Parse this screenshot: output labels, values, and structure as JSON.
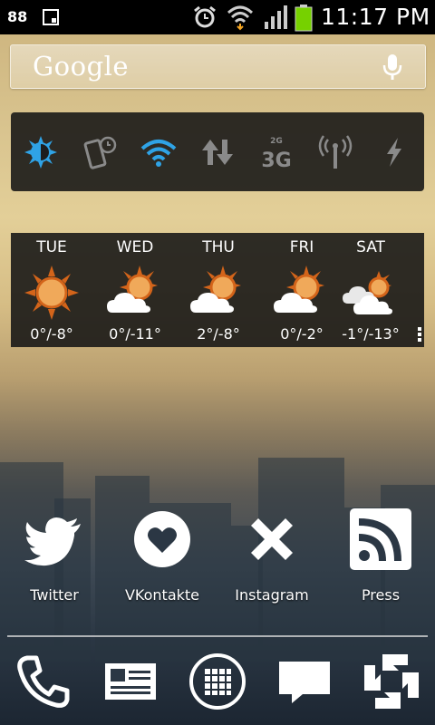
{
  "status_bar": {
    "left_number": "88",
    "time": "11:17 PM",
    "icons": [
      "sim-card-icon",
      "alarm-icon",
      "wifi-icon",
      "signal-icon",
      "battery-icon"
    ]
  },
  "search": {
    "logo_text": "Google",
    "icon": "microphone-icon"
  },
  "power_widget": {
    "items": [
      "brightness",
      "auto-rotate",
      "wifi",
      "data",
      "3g",
      "hotspot",
      "flashlight"
    ],
    "active_color": "#2fa3e6",
    "inactive_color": "#8a8a8a"
  },
  "weather": {
    "days": [
      {
        "name": "TUE",
        "temp": "0°/-8°",
        "condition": "sunny"
      },
      {
        "name": "WED",
        "temp": "0°/-11°",
        "condition": "partly-cloudy"
      },
      {
        "name": "THU",
        "temp": "2°/-8°",
        "condition": "partly-cloudy"
      },
      {
        "name": "FRI",
        "temp": "0°/-2°",
        "condition": "partly-cloudy"
      },
      {
        "name": "SAT",
        "temp": "-1°/-13°",
        "condition": "cloudy"
      }
    ]
  },
  "apps": [
    {
      "label": "Twitter",
      "icon": "twitter-bird-icon"
    },
    {
      "label": "VKontakte",
      "icon": "heart-icon"
    },
    {
      "label": "Instagram",
      "icon": "x-cross-icon"
    },
    {
      "label": "Press",
      "icon": "rss-icon"
    }
  ],
  "dock": [
    "phone-icon",
    "contacts-card-icon",
    "app-drawer-icon",
    "messaging-icon",
    "chase-logo-icon"
  ]
}
